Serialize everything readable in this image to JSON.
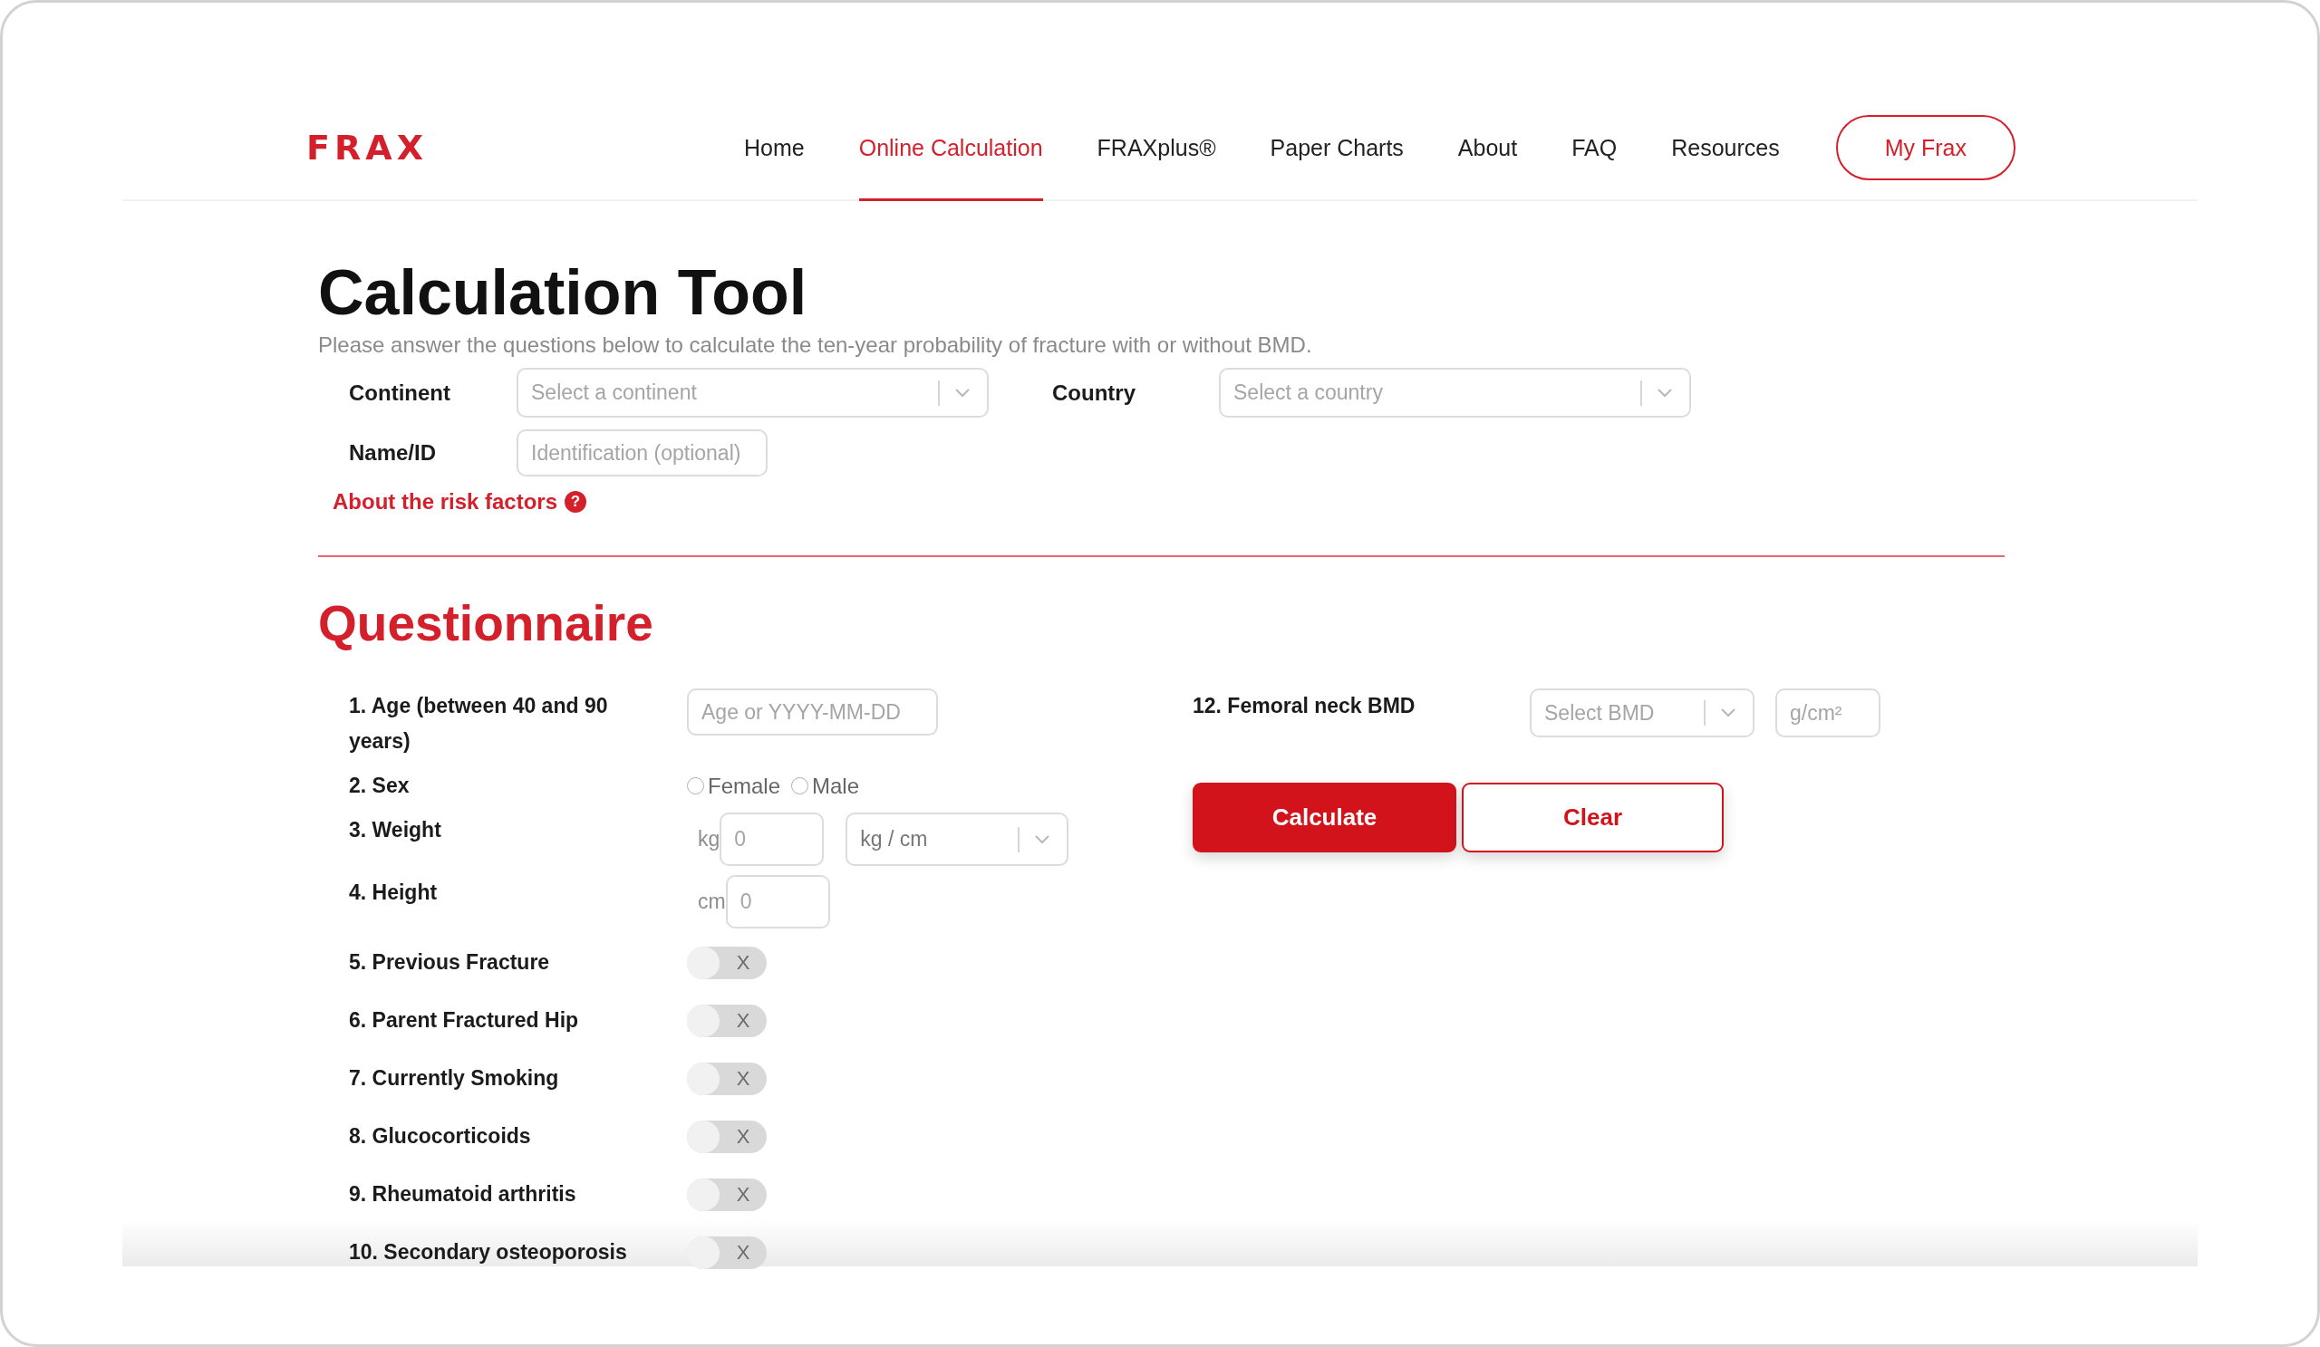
{
  "header": {
    "logo": "FRAX",
    "nav": [
      {
        "label": "Home",
        "selected": false
      },
      {
        "label": "Online Calculation",
        "selected": true
      },
      {
        "label": "FRAXplus®",
        "selected": false
      },
      {
        "label": "Paper Charts",
        "selected": false
      },
      {
        "label": "About",
        "selected": false
      },
      {
        "label": "FAQ",
        "selected": false
      },
      {
        "label": "Resources",
        "selected": false
      }
    ],
    "account_button": "My Frax"
  },
  "intro": {
    "title": "Calculation Tool",
    "subtitle": "Please answer the questions below to calculate the ten-year probability of fracture with or without BMD.",
    "fields": [
      {
        "kind": "select",
        "label": "Continent",
        "placeholder": "Select a continent"
      },
      {
        "kind": "select",
        "label": "Country",
        "placeholder": "Select a country"
      },
      {
        "kind": "input",
        "label": "Name/ID",
        "placeholder": "Identification (optional)"
      }
    ],
    "help_link": {
      "label": "About the risk factors",
      "icon_text": "?"
    }
  },
  "questionnaire": {
    "title": "Questionnaire",
    "questions": [
      {
        "kind": "text",
        "label": "1. Age (between 40 and 90 years)",
        "placeholder": "Age or YYYY-MM-DD"
      },
      {
        "kind": "radio",
        "label": "2. Sex",
        "options": [
          {
            "label": "Female",
            "selected": false
          },
          {
            "label": "Male",
            "selected": false
          }
        ]
      },
      {
        "kind": "measure",
        "label": "3. Weight",
        "unit": "kg",
        "placeholder": "0",
        "unit_select": "kg / cm"
      },
      {
        "kind": "measure",
        "label": "4. Height",
        "unit": "cm",
        "placeholder": "0"
      },
      {
        "kind": "toggle",
        "label": "5. Previous Fracture",
        "on": false,
        "text": "X"
      },
      {
        "kind": "toggle",
        "label": "6. Parent Fractured Hip",
        "on": false,
        "text": "X"
      },
      {
        "kind": "toggle",
        "label": "7. Currently Smoking",
        "on": false,
        "text": "X"
      },
      {
        "kind": "toggle",
        "label": "8. Glucocorticoids",
        "on": false,
        "text": "X"
      },
      {
        "kind": "toggle",
        "label": "9. Rheumatoid arthritis",
        "on": false,
        "text": "X"
      },
      {
        "kind": "toggle",
        "label": "10. Secondary osteoporosis",
        "on": false,
        "text": "X"
      }
    ],
    "bmd": {
      "label": "12. Femoral neck BMD",
      "placeholder": "Select BMD",
      "unit_placeholder": "g/cm²"
    },
    "buttons": [
      {
        "kind": "primary",
        "label": "Calculate"
      },
      {
        "kind": "secondary",
        "label": "Clear"
      }
    ]
  }
}
